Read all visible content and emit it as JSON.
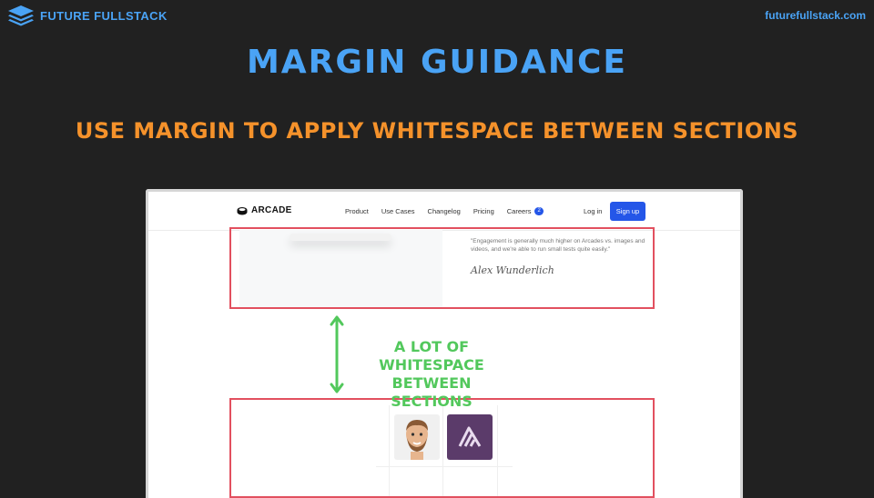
{
  "brand": {
    "name": "FUTURE FULLSTACK",
    "url": "futurefullstack.com"
  },
  "slide": {
    "title": "MARGIN GUIDANCE",
    "subtitle": "USE MARGIN TO APPLY WHITESPACE BETWEEN SECTIONS",
    "arrow_label_line1": "A LOT OF WHITESPACE",
    "arrow_label_line2": "BETWEEN SECTIONS"
  },
  "site": {
    "logo": "ARCADE",
    "nav": [
      "Product",
      "Use Cases",
      "Changelog",
      "Pricing",
      "Careers"
    ],
    "careers_badge": "2",
    "login": "Log in",
    "signup": "Sign up",
    "quote": "\"Engagement is generally much higher on Arcades vs. images and videos, and we're able to run small tests quite easily.\"",
    "signature": "Alex Wunderlich"
  },
  "colors": {
    "background": "#212121",
    "brand_blue": "#4aa3f5",
    "subtitle_orange": "#f5922b",
    "highlight_red": "#e2505f",
    "annotation_green": "#52c85c",
    "button_blue": "#2456e8"
  }
}
